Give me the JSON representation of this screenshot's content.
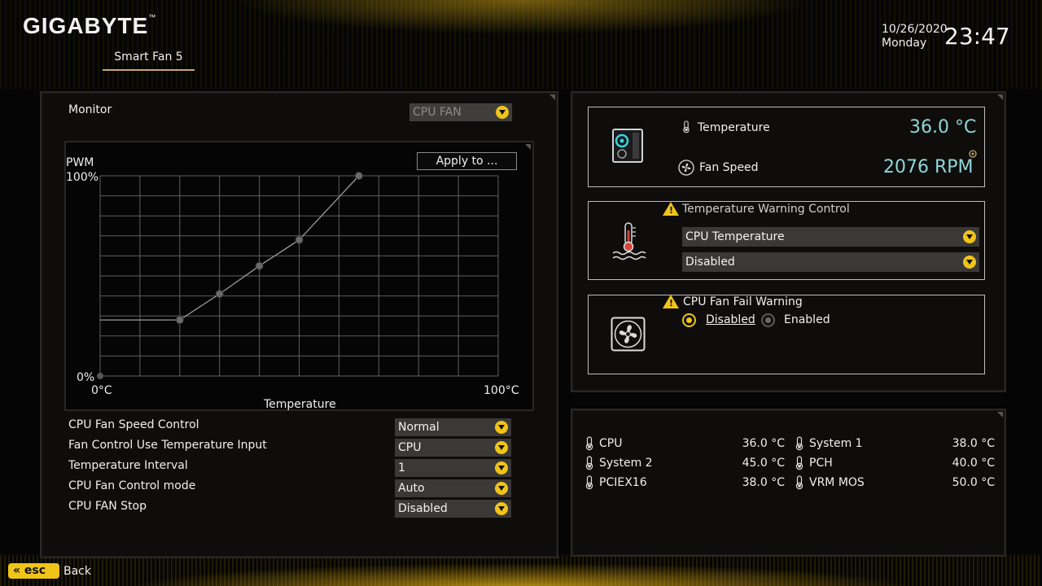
{
  "header": {
    "brand": "GIGABYTE",
    "trademark": "™",
    "tab": "Smart Fan 5",
    "date": "10/26/2020",
    "weekday": "Monday",
    "time": "23:47"
  },
  "monitor": {
    "label": "Monitor",
    "selected": "CPU FAN"
  },
  "graph": {
    "apply_label": "Apply to ...",
    "y_label": "PWM",
    "y_max_label": "100%",
    "y_min_label": "0%",
    "x_min_label": "0°C",
    "x_max_label": "100°C",
    "x_label": "Temperature"
  },
  "chart_data": {
    "type": "line",
    "xlabel": "Temperature",
    "ylabel": "PWM",
    "xlim": [
      0,
      100
    ],
    "ylim": [
      0,
      100
    ],
    "grid": true,
    "x": [
      0,
      20,
      30,
      40,
      50,
      65
    ],
    "values": [
      28,
      28,
      41,
      55,
      68,
      100
    ],
    "series": [
      {
        "values": [
          28,
          28,
          41,
          55,
          68,
          100
        ]
      }
    ]
  },
  "settings": [
    {
      "label": "CPU Fan Speed Control",
      "value": "Normal"
    },
    {
      "label": "Fan Control Use Temperature Input",
      "value": "CPU"
    },
    {
      "label": "Temperature Interval",
      "value": "1"
    },
    {
      "label": "CPU Fan Control mode",
      "value": "Auto"
    },
    {
      "label": "CPU FAN Stop",
      "value": "Disabled"
    }
  ],
  "status": {
    "temperature_label": "Temperature",
    "temperature_value": "36.0 °C",
    "fan_speed_label": "Fan Speed",
    "fan_speed_value": "2076 RPM"
  },
  "temp_warning": {
    "title": "Temperature Warning Control",
    "source": "CPU Temperature",
    "value": "Disabled"
  },
  "fan_fail": {
    "title": "CPU Fan Fail Warning",
    "option_disabled": "Disabled",
    "option_enabled": "Enabled",
    "selected": "Disabled"
  },
  "sensors": [
    {
      "name": "CPU",
      "value": "36.0 °C"
    },
    {
      "name": "System 1",
      "value": "38.0 °C"
    },
    {
      "name": "System 2",
      "value": "45.0 °C"
    },
    {
      "name": "PCH",
      "value": "40.0 °C"
    },
    {
      "name": "PCIEX16",
      "value": "38.0 °C"
    },
    {
      "name": "VRM MOS",
      "value": "50.0 °C"
    }
  ],
  "footer": {
    "esc_label": "esc",
    "back_label": "Back"
  },
  "colors": {
    "accent": "#f0c419",
    "value_cyan": "#8fd6d8"
  }
}
